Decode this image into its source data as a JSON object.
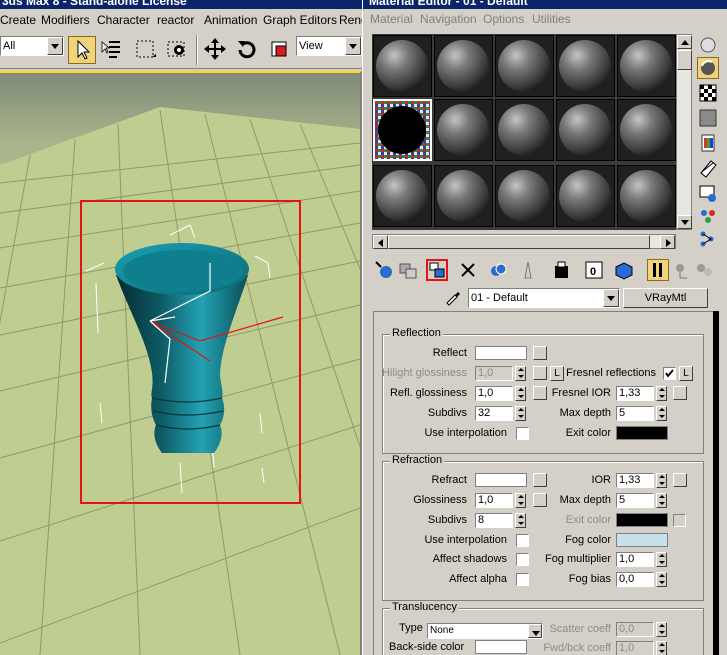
{
  "max": {
    "title": "3ds Max 8 - Stand-alone License",
    "menu": [
      "Create",
      "Modifiers",
      "Character",
      "reactor",
      "Animation",
      "Graph Editors",
      "Rend"
    ],
    "selection_filter": "All",
    "reference_coord": "View"
  },
  "material_editor": {
    "title": "Material Editor - 01 - Default",
    "menu": [
      "Material",
      "Navigation",
      "Options",
      "Utilities"
    ],
    "material_name": "01 - Default",
    "material_type": "VRayMtl",
    "reflection": {
      "title": "Reflection",
      "reflect_label": "Reflect",
      "reflect_color": "#ffffff",
      "hilight_glossiness_label": "Hilight glossiness",
      "hilight_glossiness": "1,0",
      "lock_label": "L",
      "fresnel_reflections_label": "Fresnel reflections",
      "fresnel_lock_label": "L",
      "refl_glossiness_label": "Refl. glossiness",
      "refl_glossiness": "1,0",
      "fresnel_ior_label": "Fresnel IOR",
      "fresnel_ior": "1,33",
      "subdivs_label": "Subdivs",
      "subdivs": "32",
      "max_depth_label": "Max depth",
      "max_depth": "5",
      "use_interpolation_label": "Use interpolation",
      "exit_color_label": "Exit color",
      "exit_color": "#000000"
    },
    "refraction": {
      "title": "Refraction",
      "refract_label": "Refract",
      "refract_color": "#ffffff",
      "ior_label": "IOR",
      "ior": "1,33",
      "glossiness_label": "Glossiness",
      "glossiness": "1,0",
      "max_depth_label": "Max depth",
      "max_depth": "5",
      "subdivs_label": "Subdivs",
      "subdivs": "8",
      "exit_color_label": "Exit color",
      "exit_color": "#000000",
      "use_interpolation_label": "Use interpolation",
      "fog_color_label": "Fog color",
      "fog_color": "#c7e1ea",
      "affect_shadows_label": "Affect shadows",
      "fog_multiplier_label": "Fog multiplier",
      "fog_multiplier": "1,0",
      "affect_alpha_label": "Affect alpha",
      "fog_bias_label": "Fog bias",
      "fog_bias": "0,0"
    },
    "translucency": {
      "title": "Translucency",
      "type_label": "Type",
      "type_value": "None",
      "scatter_coeff_label": "Scatter coeff",
      "scatter_coeff": "0,0",
      "back_side_color_label": "Back-side color",
      "back_side_color": "#ffffff",
      "fwd_bck_coeff_label": "Fwd/bck coeff",
      "fwd_bck_coeff": "1,0"
    }
  }
}
